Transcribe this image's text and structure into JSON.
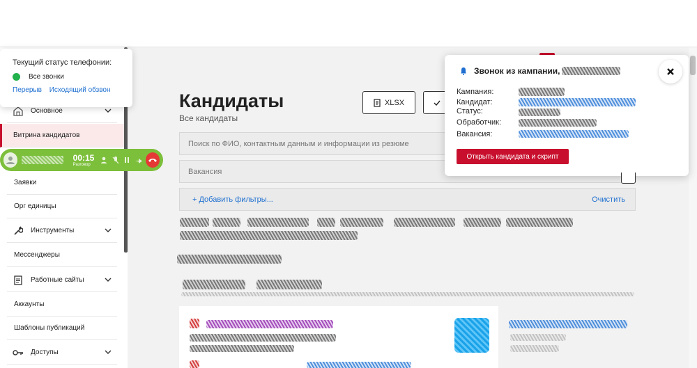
{
  "telephony": {
    "title": "Текущий статус телефонии:",
    "status": "Все звонки",
    "status_color": "#22b14c",
    "link_pause": "Перерыв",
    "link_outbound": "Исходящий обзвон"
  },
  "sidebar": {
    "items": [
      {
        "label": "Основное",
        "icon": "home-icon",
        "has_chevron": true
      },
      {
        "label": "Витрина кандидатов",
        "active": true
      },
      {
        "label": "Заявки"
      },
      {
        "label": "Орг единицы"
      },
      {
        "label": "Инструменты",
        "icon": "wrench-icon",
        "has_chevron": true
      },
      {
        "label": "Мессенджеры"
      },
      {
        "label": "Работные сайты",
        "icon": "document-icon",
        "has_chevron": true
      },
      {
        "label": "Аккаунты"
      },
      {
        "label": "Шаблоны публикаций"
      },
      {
        "label": "Доступы",
        "icon": "key-icon",
        "has_chevron": true
      }
    ]
  },
  "call": {
    "timer": "00:15",
    "state": "Разговор",
    "bar_color": "#7cbf3b"
  },
  "page": {
    "title": "Кандидаты",
    "subtitle": "Все кандидаты",
    "xlsx_label": "XLSX",
    "search_placeholder": "Поиск по ФИО, контактным данным и информации из резюме",
    "vacancy_placeholder": "Вакансия",
    "add_filters": "+ Добавить фильтры...",
    "clear": "Очистить"
  },
  "notification": {
    "title": "Звонок из кампании,",
    "fields": [
      {
        "label": "Кампания:"
      },
      {
        "label": "Кандидат:"
      },
      {
        "label": "Статус:"
      },
      {
        "label": "Обработчик:"
      },
      {
        "label": "Вакансия:"
      }
    ],
    "open_button": "Открыть кандидата и скрипт",
    "accent": "#c8102e"
  }
}
